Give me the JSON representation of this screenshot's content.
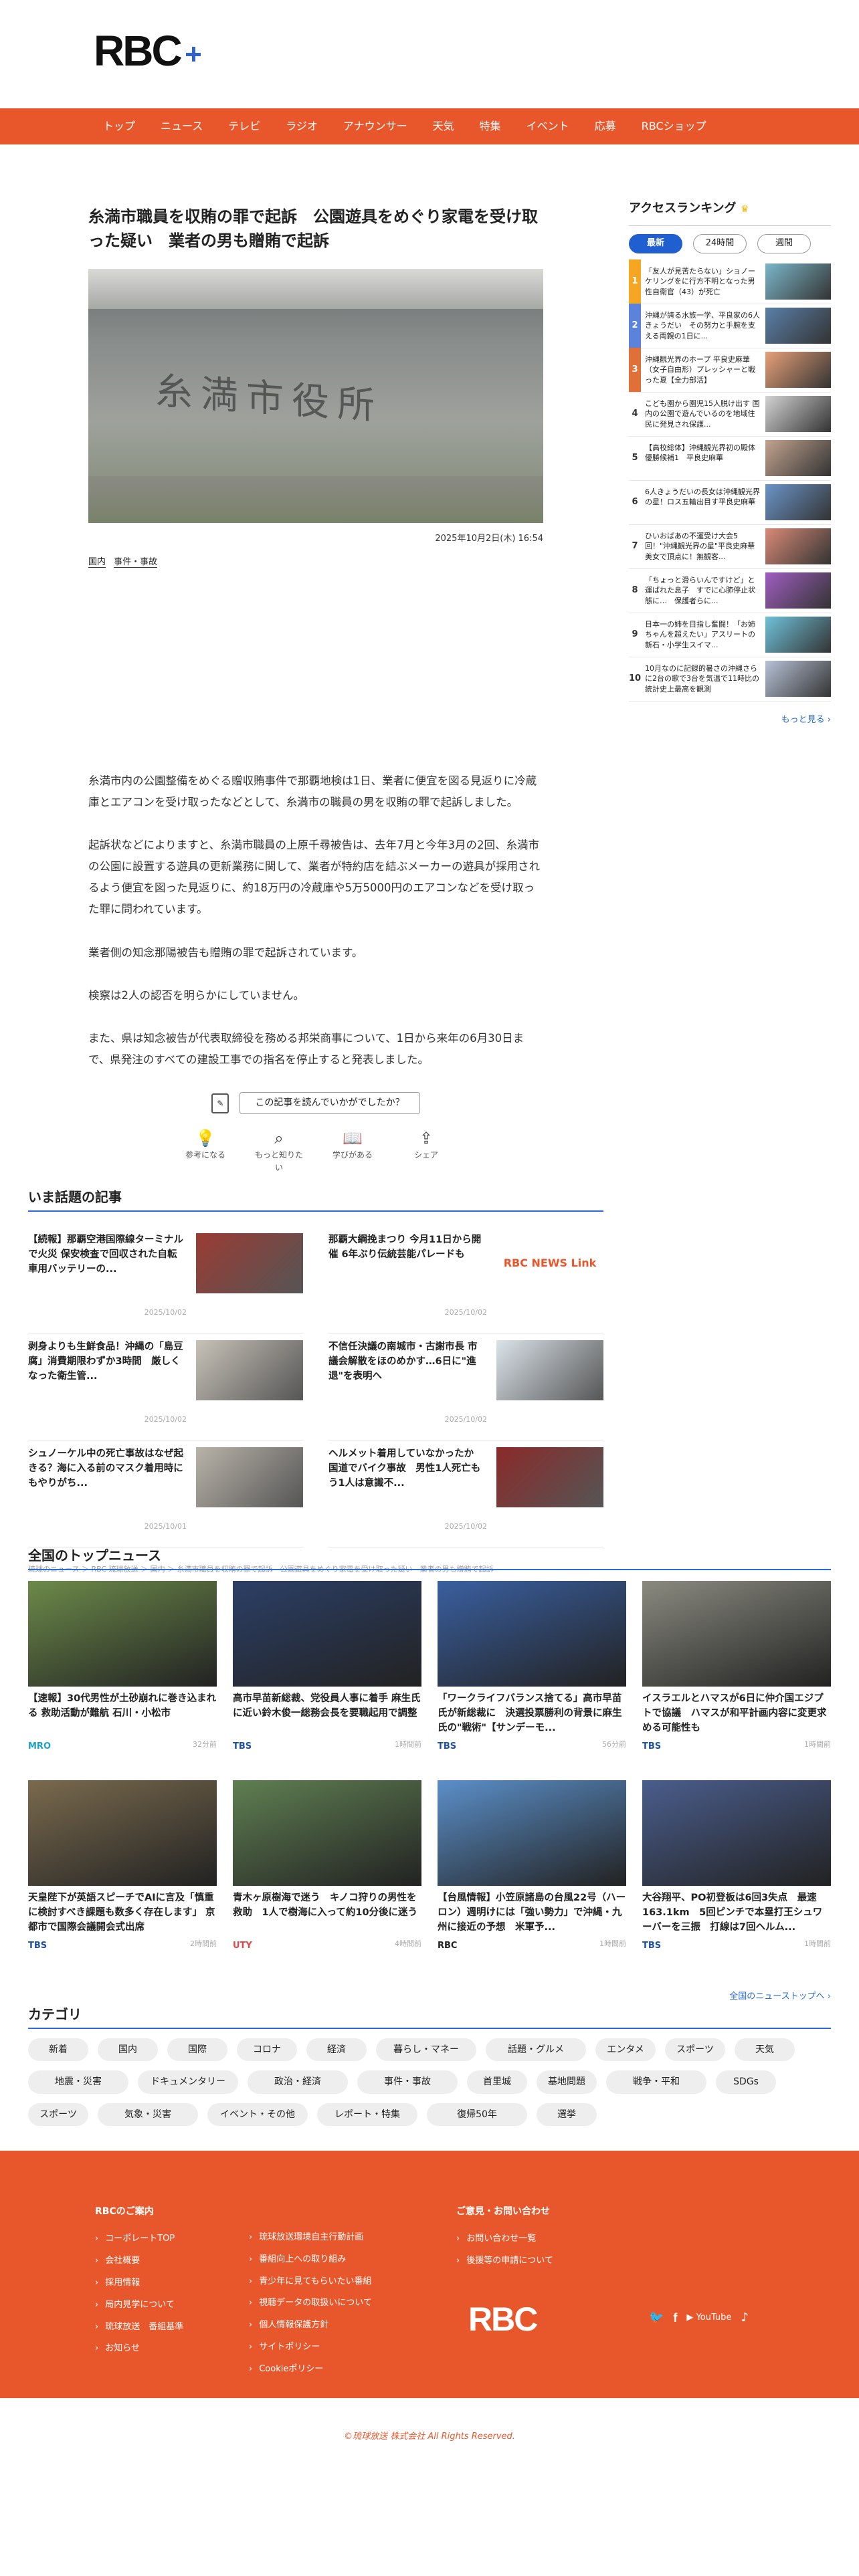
{
  "header": {
    "logo": "RBC"
  },
  "nav": [
    "トップ",
    "ニュース",
    "テレビ",
    "ラジオ",
    "アナウンサー",
    "天気",
    "特集",
    "イベント",
    "応募",
    "RBCショップ"
  ],
  "article": {
    "title": "糸満市職員を収賄の罪で起訴　公園遊具をめぐり家電を受け取った疑い　業者の男も贈賄で起訴",
    "hero_text": "糸満市役所",
    "date": "2025年10月2日(木) 16:54",
    "tags": [
      "国内",
      "事件・事故"
    ],
    "paragraphs": [
      "糸満市内の公園整備をめぐる贈収賄事件で那覇地検は1日、業者に便宜を図る見返りに冷蔵庫とエアコンを受け取ったなどとして、糸満市の職員の男を収賄の罪で起訴しました。",
      "起訴状などによりますと、糸満市職員の上原千尋被告は、去年7月と今年3月の2回、糸満市の公園に設置する遊具の更新業務に関して、業者が特約店を結ぶメーカーの遊具が採用されるよう便宜を図った見返りに、約18万円の冷蔵庫や5万5000円のエアコンなどを受け取った罪に問われています。",
      "業者側の知念那陽被告も贈賄の罪で起訴されています。",
      "検察は2人の認否を明らかにしていません。",
      "また、県は知念被告が代表取締役を務める邦栄商事について、1日から来年の6月30日まで、県発注のすべての建設工事での指名を停止すると発表しました。"
    ],
    "feedback": {
      "question": "この記事を読んでいかがでしたか？",
      "actions": [
        "参考になる",
        "もっと知りたい",
        "学びがある",
        "シェア"
      ]
    }
  },
  "ranking": {
    "title": "アクセスランキング",
    "tabs": [
      "最新",
      "24時間",
      "週間"
    ],
    "items": [
      {
        "no": "1",
        "text": "「友人が見苦たらない」ショノーケリングをに行方不明となった男性自衛官（43）が死亡"
      },
      {
        "no": "2",
        "text": "沖縄が誇る水族一学、平良家の6人きょうだい　その努力と手腕を支える両親の1日に..."
      },
      {
        "no": "3",
        "text": "沖縄観光界のホープ 平良史麻華（女子自由形）プレッシャーと戦った夏【全力部活】"
      },
      {
        "no": "4",
        "text": "こども園から園児15人脱け出す 国内の公園で遊んでいるのを地域住民に発見され保護..."
      },
      {
        "no": "5",
        "text": "【高校総体】沖縄観光界初の殿体優勝候補1　平良史麻華"
      },
      {
        "no": "6",
        "text": "6人きょうだいの長女は沖縄観光界の星！ロス五輪出目す平良史麻華"
      },
      {
        "no": "7",
        "text": "ひいおばあの不運受け大会5回！\"沖縄観光界の星\"平良史麻華　美女で頂点に！無観客..."
      },
      {
        "no": "8",
        "text": "「ちょっと滑らいんですけど」と運ばれた息子　すでに心肺停止状態に…　保護者らに..."
      },
      {
        "no": "9",
        "text": "日本一の姉を目指し奮闘！「お姉ちゃんを超えたい」アスリートの新石・小学生スイマ..."
      },
      {
        "no": "10",
        "text": "10月なのに記録的暑さの沖縄さらに2台の歌で3台を気温で11時比の統計史上最高を観測"
      }
    ],
    "more": "もっと見る"
  },
  "hot": {
    "title": "いま話題の記事",
    "items": [
      {
        "text": "【続報】那覇空港国際線ターミナルで火災 保安検査で回収された自転車用バッテリーの...",
        "date": "2025/10/02"
      },
      {
        "text": "那覇大綱挽まつり 今月11日から開催 6年ぶり伝統芸能パレードも",
        "date": "2025/10/02"
      },
      {
        "text": "剥身よりも生鮮食品！沖縄の「島豆腐」消費期限わずか3時間　厳しくなった衛生管...",
        "date": "2025/10/02"
      },
      {
        "text": "不信任決議の南城市・古謝市長 市議会解散をほのめかす…6日に\"進退\"を表明へ",
        "date": "2025/10/02"
      },
      {
        "text": "シュノーケル中の死亡事故はなぜ起きる？海に入る前のマスク着用時にもやりがち...",
        "date": "2025/10/01"
      },
      {
        "text": "ヘルメット着用していなかったか　国道でバイク事故　男性1人死亡もう1人は意識不...",
        "date": "2025/10/02"
      }
    ],
    "link_logo": "RBC NEWS Link"
  },
  "breadcrumb": "琉球のニュース ＞ RBC 琉球放送 ＞ 国内 ＞ 糸満市職員を収賄の罪で起訴　公園遊具をめぐり家電を受け取った疑い　業者の男も贈賄で起訴",
  "topnews": {
    "title": "全国のトップニュース",
    "items": [
      {
        "text": "【速報】30代男性が土砂崩れに巻き込まれる 救助活動が難航 石川・小松市",
        "src": "MRO",
        "date": "32分前"
      },
      {
        "text": "高市早苗新総裁、党役員人事に着手 麻生氏に近い鈴木俊一総務会長を要職起用で調整",
        "src": "TBS",
        "date": "1時間前"
      },
      {
        "text": "「ワークライフバランス捨てる」高市早苗氏が新総裁に　決選投票勝利の背景に麻生氏の\"戦術\"【サンデーモ...",
        "src": "TBS",
        "date": "56分前"
      },
      {
        "text": "イスラエルとハマスが6日に仲介国エジプトで協議　ハマスが和平計画内容に変更求める可能性も",
        "src": "TBS",
        "date": "1時間前"
      },
      {
        "text": "天皇陛下が英語スピーチでAIに言及「慎重に検討すべき課題も数多く存在します」 京都市で国際会議開会式出席",
        "src": "TBS",
        "date": "2時間前"
      },
      {
        "text": "青木ヶ原樹海で迷う　キノコ狩りの男性を救助　1人で樹海に入って約10分後に迷う",
        "src": "UTY",
        "date": "4時間前"
      },
      {
        "text": "【台風情報】小笠原諸島の台風22号（ハーロン）週明けには「強い勢力」で沖縄・九州に接近の予想　米軍予...",
        "src": "RBC",
        "date": "1時間前"
      },
      {
        "text": "大谷翔平、PO初登板は6回3失点　最速163.1km　5回ピンチで本塁打王シュワーバーを三振　打線は7回ヘルム...",
        "src": "TBS",
        "date": "1時間前"
      }
    ],
    "more": "全国のニューストップへ"
  },
  "categories": {
    "title": "カテゴリ",
    "items": [
      "新着",
      "国内",
      "国際",
      "コロナ",
      "経済",
      "暮らし・マネー",
      "話題・グルメ",
      "エンタメ",
      "スポーツ",
      "天気",
      "地震・災害",
      "ドキュメンタリー",
      "政治・経済",
      "事件・事故",
      "首里城",
      "基地問題",
      "戦争・平和",
      "SDGs",
      "スポーツ",
      "気象・災害",
      "イベント・その他",
      "レポート・特集",
      "復帰50年",
      "選挙"
    ]
  },
  "footer": {
    "left_title": "RBCのご案内",
    "left_col1": [
      "コーポレートTOP",
      "会社概要",
      "採用情報",
      "局内見学について",
      "琉球放送　番組基準",
      "お知らせ"
    ],
    "left_col2": [
      "琉球放送環境自主行動計画",
      "番組向上への取り組み",
      "青少年に見てもらいたい番組",
      "視聴データの取扱いについて",
      "個人情報保護方針",
      "サイトポリシー",
      "Cookieポリシー"
    ],
    "right_title": "ご意見・お問い合わせ",
    "right_col": [
      "お問い合わせ一覧",
      "後援等の申請について"
    ],
    "logo": "RBC",
    "social": [
      "twitter-icon",
      "facebook-icon",
      "youtube-icon",
      "tiktok-icon"
    ],
    "youtube_label": "YouTube"
  },
  "copyright": "©琉球放送 株式会社 All Rights Reserved."
}
